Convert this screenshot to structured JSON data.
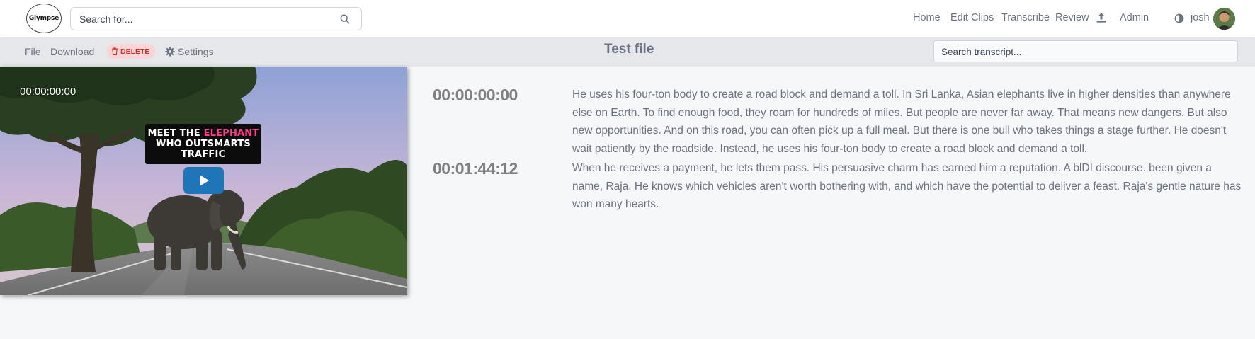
{
  "app": {
    "logo_text": "Glympse"
  },
  "search": {
    "placeholder": "Search for..."
  },
  "nav": {
    "links": [
      "Home",
      "Edit Clips",
      "Transcribe",
      "Review",
      "Admin"
    ],
    "user": "josh"
  },
  "toolbar": {
    "file": "File",
    "download": "Download",
    "delete": "DELETE",
    "settings": "Settings",
    "title": "Test file",
    "transcript_search_placeholder": "Search transcript..."
  },
  "video": {
    "timecode": "00:00:00:00",
    "thumbnail_line1_a": "MEET THE ",
    "thumbnail_line1_b": "ELEPHANT",
    "thumbnail_line2": "WHO OUTSMARTS",
    "thumbnail_line3": "TRAFFIC"
  },
  "transcript": [
    {
      "time": "00:00:00:00",
      "text": "He uses his four-ton body to create a road block and demand a toll. In Sri Lanka, Asian elephants live in higher densities than anywhere else on Earth. To find enough food, they roam for hundreds of miles. But people are never far away. That means new dangers. But also new opportunities. And on this road, you can often pick up a full meal. But there is one bull who takes things a stage further. He doesn't wait patiently by the roadside. Instead, he uses his four-ton body to create a road block and demand a toll."
    },
    {
      "time": "00:01:44:12",
      "text": "When he receives a payment, he lets them pass. His persuasive charm has earned him a reputation. A blDI discourse. been given a name, Raja. He knows which vehicles aren't worth bothering with, and which have the potential to deliver a feast. Raja's gentle nature has won many hearts."
    }
  ],
  "colors": {
    "accent_play": "#1e75b8",
    "delete_bg": "#fbd5d5",
    "delete_text": "#c0392b",
    "thumbnail_pink": "#ff3d8b"
  }
}
